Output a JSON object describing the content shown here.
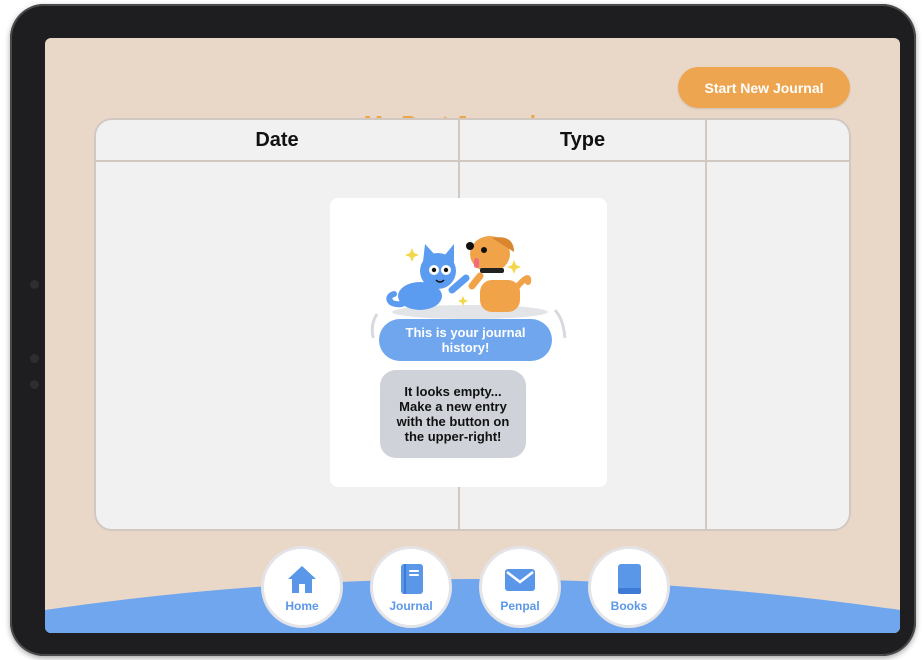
{
  "header": {
    "title": "My Past Journals",
    "start_button_label": "Start New Journal"
  },
  "table": {
    "columns": [
      "Date",
      "Type",
      ""
    ]
  },
  "empty_state": {
    "title": "This is your journal history!",
    "message": "It looks empty... Make a new entry with the button on the upper-right!"
  },
  "nav": {
    "items": [
      {
        "label": "Home",
        "icon": "home-icon"
      },
      {
        "label": "Journal",
        "icon": "journal-icon"
      },
      {
        "label": "Penpal",
        "icon": "mail-icon"
      },
      {
        "label": "Books",
        "icon": "book-icon"
      }
    ]
  },
  "colors": {
    "background": "#e9d8c8",
    "accent_orange": "#eea54f",
    "accent_blue": "#6fa6ee"
  }
}
